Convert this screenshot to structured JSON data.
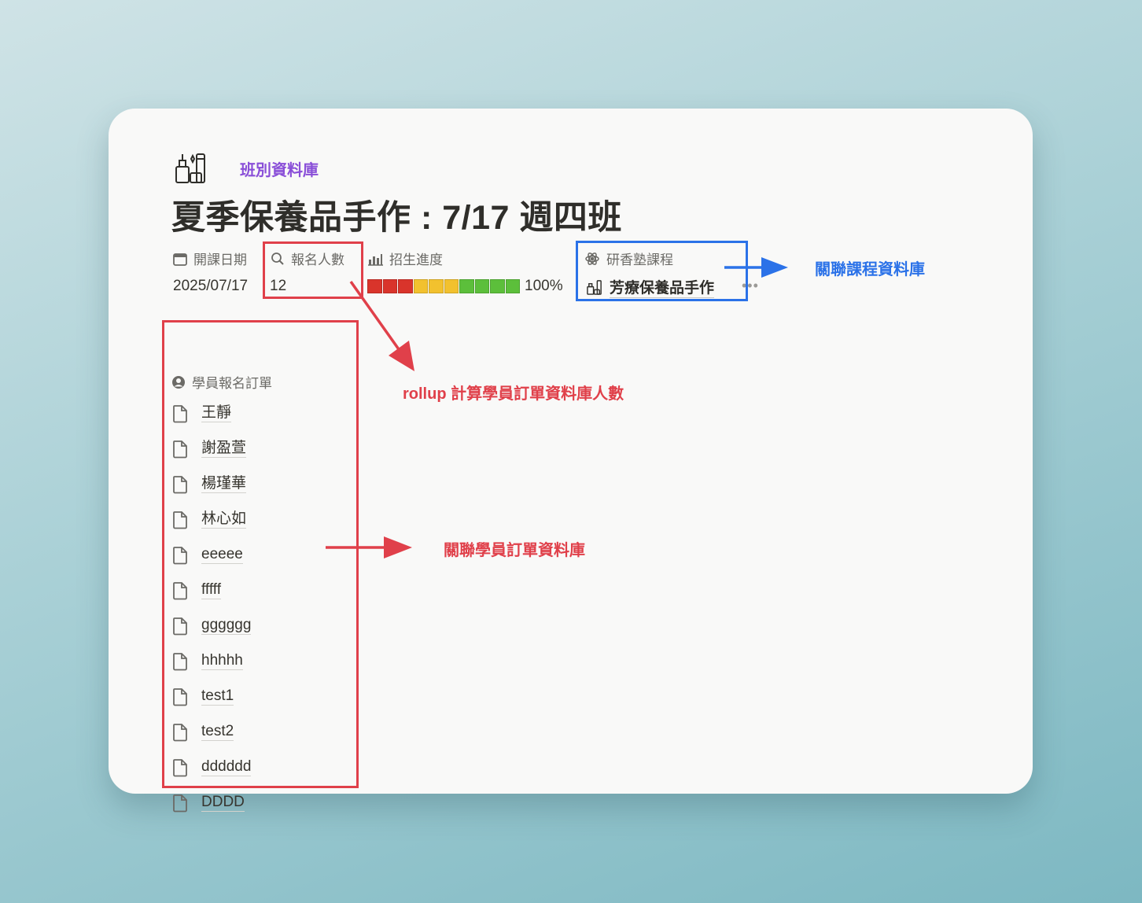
{
  "page": {
    "database_label": "班別資料庫",
    "title": "夏季保養品手作 : 7/17 週四班",
    "icon": "cosmetics-icon"
  },
  "properties": {
    "start_date": {
      "label": "開課日期",
      "icon": "calendar-icon",
      "value": "2025/07/17"
    },
    "enrollment_count": {
      "label": "報名人數",
      "icon": "search-icon",
      "value": "12"
    },
    "recruit_progress": {
      "label": "招生進度",
      "icon": "chart-icon",
      "value": "100%",
      "fraction": 1.0,
      "segment_colors": [
        "#d9342b",
        "#d9342b",
        "#d9342b",
        "#f2c12e",
        "#f2c12e",
        "#f2c12e",
        "#5cbf3b",
        "#5cbf3b",
        "#5cbf3b",
        "#5cbf3b"
      ]
    },
    "course": {
      "label": "研香塾課程",
      "icon": "atom-icon",
      "value": "芳療保養品手作",
      "more": "•••"
    }
  },
  "students": {
    "label": "學員報名訂單",
    "icon": "person-circle-icon",
    "items": [
      "王靜",
      "謝盈萱",
      "楊瑾華",
      "林心如",
      "eeeee",
      "fffff",
      "gggggg",
      "hhhhh",
      "test1",
      "test2",
      "dddddd",
      "DDDD"
    ]
  },
  "annotations": {
    "rollup_note": "rollup 計算學員訂單資料庫人數",
    "student_relation_note": "關聯學員訂單資料庫",
    "course_relation_note": "關聯課程資料庫"
  },
  "colors": {
    "annotation_red": "#e0404a",
    "annotation_blue": "#2b72e8",
    "database_label": "#8a4fd8"
  }
}
